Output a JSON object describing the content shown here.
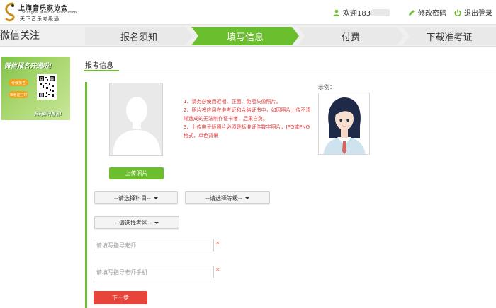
{
  "header": {
    "logo_line1": "上海音乐家协会",
    "logo_line2": "Shanghai Musician Association",
    "logo_line3": "天下音乐考级通",
    "welcome_text": "欢迎183",
    "change_password": "修改密码",
    "logout": "退出登录"
  },
  "nav": {
    "wechat_title": "微信关注",
    "steps": [
      {
        "label": "报名须知",
        "active": false
      },
      {
        "label": "填写信息",
        "active": true
      },
      {
        "label": "付费",
        "active": false
      },
      {
        "label": "下载准考证",
        "active": false
      }
    ]
  },
  "ad": {
    "title": "微信报名开通啦!",
    "btn1": "考级报名",
    "btn2": "准考证打印",
    "footer": "扫码即可报名!"
  },
  "form": {
    "section_title": "报考信息",
    "upload_label": "上传照片",
    "notes": [
      "1、请务必使用近期、正面、免冠头像照片。",
      "2、照片将应用在准考证和合格证书中，如因照片上传不清晰造成的无法制作证书者，后果自负。",
      "3、上传电子版照片必须是标准证件数字照片，JPG或PNG格式，单色背景"
    ],
    "example_label": "示例：",
    "subject_select": "--请选择科目--",
    "level_select": "--请选择等级--",
    "area_select": "--请选择考区--",
    "teacher_placeholder": "请填写指导老师",
    "teacher_phone_placeholder": "请填写指导老师手机",
    "required_mark": "*",
    "next_label": "下一步"
  },
  "colors": {
    "accent_green": "#6bbf2e",
    "danger_red": "#e7453b",
    "note_red": "#e43c3c"
  }
}
